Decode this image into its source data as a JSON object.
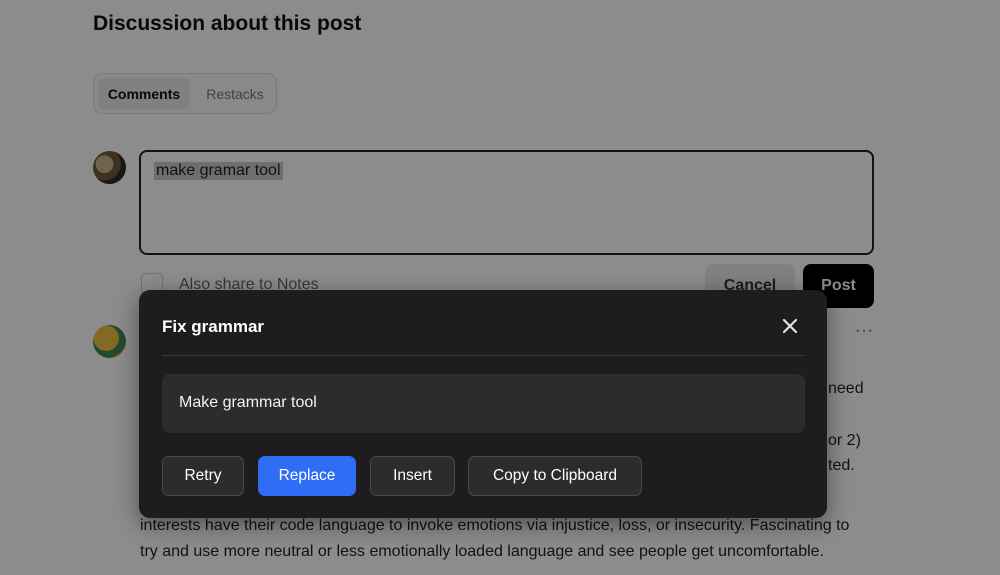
{
  "page": {
    "heading": "Discussion about this post",
    "tabs": [
      {
        "label": "Comments",
        "active": true
      },
      {
        "label": "Restacks",
        "active": false
      }
    ],
    "composer": {
      "text": "make gramar tool",
      "share_label": "Also share to Notes",
      "cancel_label": "Cancel",
      "post_label": "Post"
    },
    "comment": {
      "more_icon": "more-horizontal-icon",
      "partial_right_1": "need",
      "partial_right_2": "or 2)",
      "partial_right_3": "ted.",
      "line_1": "interests have their code language to invoke emotions via injustice, loss, or insecurity. Fascinating to",
      "line_2": "try and use more neutral or less emotionally loaded language and see people get uncomfortable."
    }
  },
  "modal": {
    "title": "Fix grammar",
    "close_icon": "close-icon",
    "result_text": "Make grammar tool",
    "buttons": {
      "retry": "Retry",
      "replace": "Replace",
      "insert": "Insert",
      "copy": "Copy to Clipboard"
    }
  },
  "colors": {
    "overlay": "rgba(0,0,0,0.45)",
    "modal_bg": "#1d1d1f",
    "primary_button": "#2f6df6",
    "post_button": "#000000"
  }
}
